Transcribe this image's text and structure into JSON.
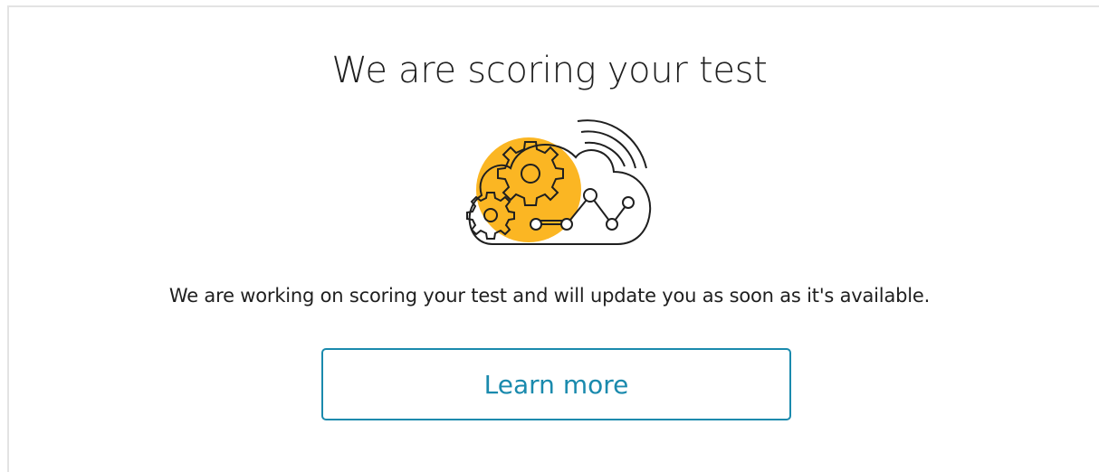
{
  "page": {
    "title": "We are scoring your test",
    "message": "We are working on scoring your test and will update you as soon as it's available.",
    "learn_more_label": "Learn more"
  },
  "illustration": {
    "icon": "cloud-gears-analytics-icon",
    "accent_color": "#fbb623",
    "line_color": "#1f1f1f"
  },
  "colors": {
    "button_accent": "#1a8aad",
    "text": "#1f1f1f",
    "border": "#e3e3e3"
  }
}
